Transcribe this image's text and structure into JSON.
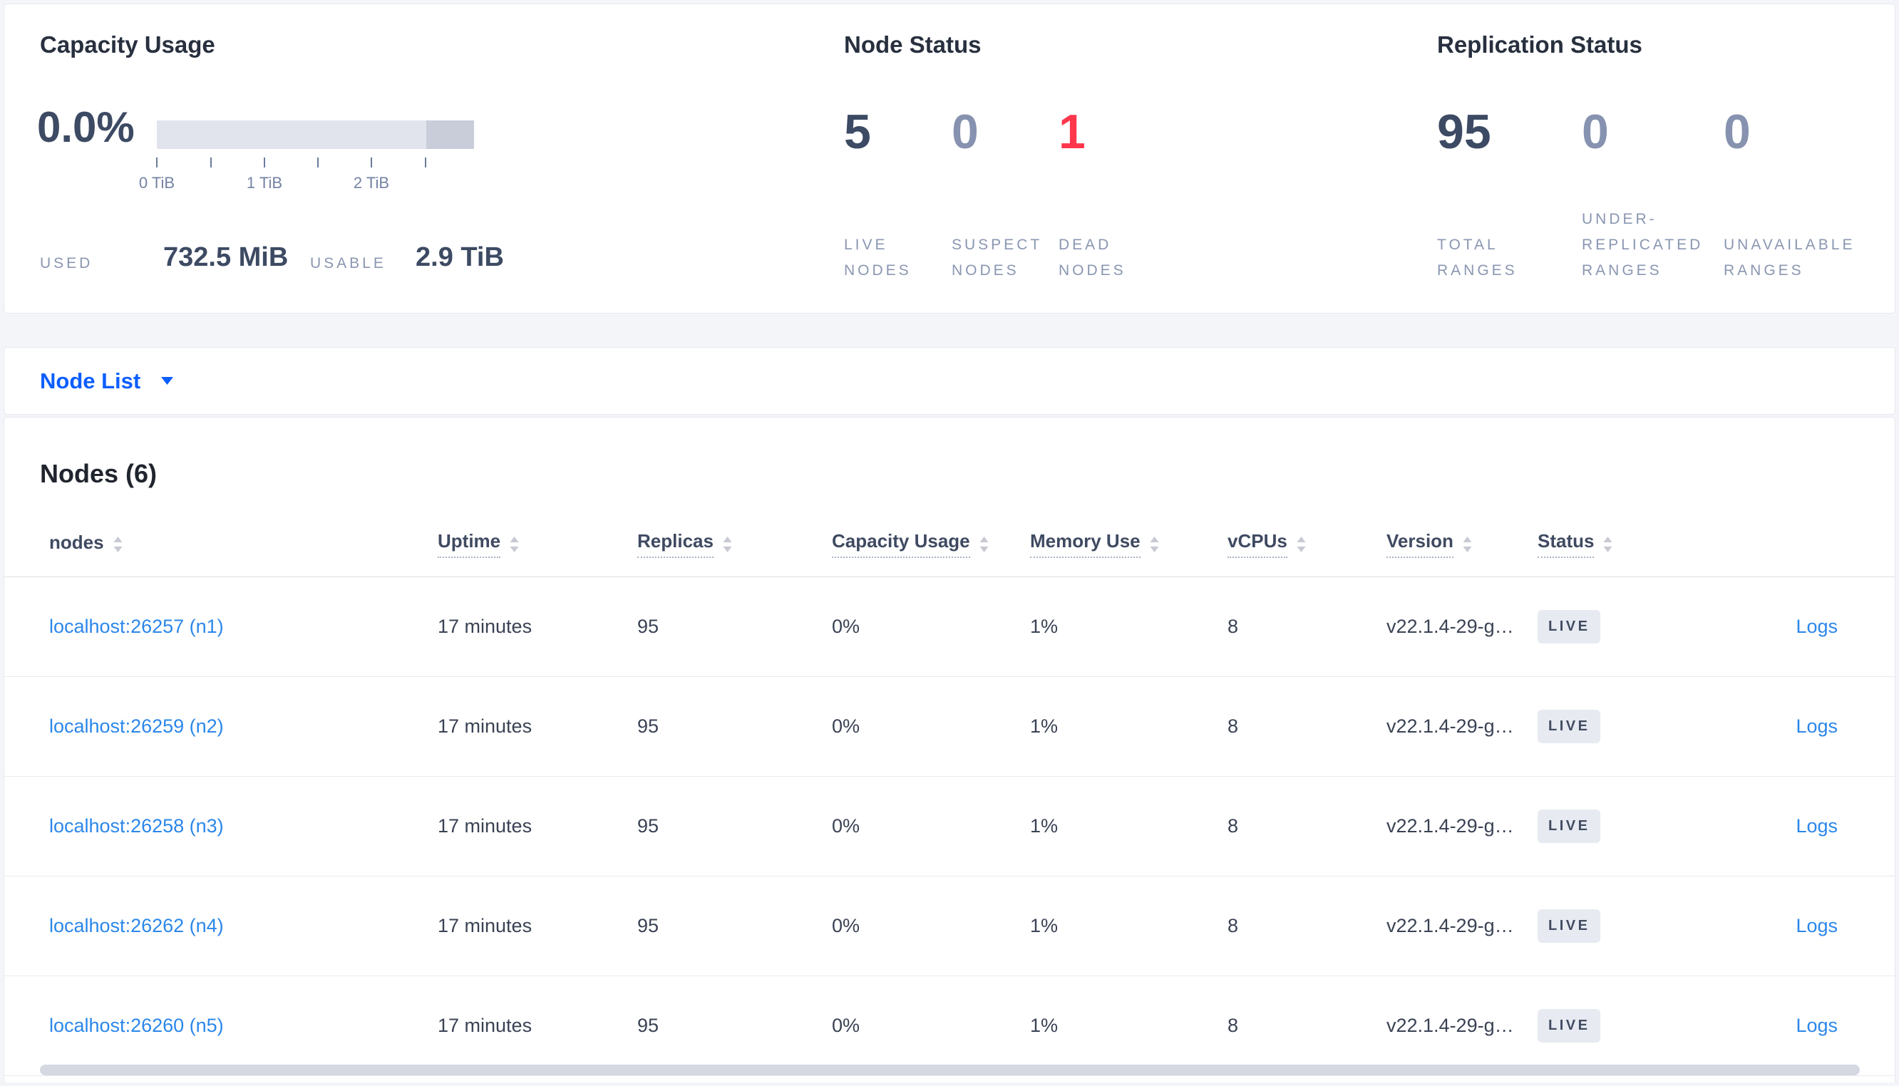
{
  "overview": {
    "capacity": {
      "title": "Capacity Usage",
      "percent": "0.0%",
      "tick_labels": [
        "0 TiB",
        "1 TiB",
        "2 TiB"
      ],
      "used_label": "USED",
      "used_value": "732.5 MiB",
      "usable_label": "USABLE",
      "usable_value": "2.9 TiB"
    },
    "node_status": {
      "title": "Node Status",
      "stats": [
        {
          "value": "5",
          "lines": [
            "LIVE",
            "NODES"
          ]
        },
        {
          "value": "0",
          "lines": [
            "SUSPECT",
            "NODES"
          ]
        },
        {
          "value": "1",
          "lines": [
            "DEAD",
            "NODES"
          ]
        }
      ]
    },
    "replication": {
      "title": "Replication Status",
      "stats": [
        {
          "value": "95",
          "lines": [
            "TOTAL",
            "RANGES"
          ]
        },
        {
          "value": "0",
          "lines": [
            "UNDER-",
            "REPLICATED",
            "RANGES"
          ]
        },
        {
          "value": "0",
          "lines": [
            "UNAVAILABLE",
            "RANGES"
          ]
        }
      ]
    }
  },
  "view_selector": {
    "label": "Node List"
  },
  "nodes": {
    "title": "Nodes (6)",
    "columns": [
      {
        "label": "nodes"
      },
      {
        "label": "Uptime"
      },
      {
        "label": "Replicas"
      },
      {
        "label": "Capacity Usage"
      },
      {
        "label": "Memory Use"
      },
      {
        "label": "vCPUs"
      },
      {
        "label": "Version"
      },
      {
        "label": "Status"
      }
    ],
    "rows": [
      {
        "address": "localhost:26257 (n1)",
        "uptime": "17 minutes",
        "replicas": "95",
        "capacity": "0%",
        "memory": "1%",
        "vcpus": "8",
        "version": "v22.1.4-29-g…",
        "status": "LIVE",
        "logs": "Logs"
      },
      {
        "address": "localhost:26259 (n2)",
        "uptime": "17 minutes",
        "replicas": "95",
        "capacity": "0%",
        "memory": "1%",
        "vcpus": "8",
        "version": "v22.1.4-29-g…",
        "status": "LIVE",
        "logs": "Logs"
      },
      {
        "address": "localhost:26258 (n3)",
        "uptime": "17 minutes",
        "replicas": "95",
        "capacity": "0%",
        "memory": "1%",
        "vcpus": "8",
        "version": "v22.1.4-29-g…",
        "status": "LIVE",
        "logs": "Logs"
      },
      {
        "address": "localhost:26262 (n4)",
        "uptime": "17 minutes",
        "replicas": "95",
        "capacity": "0%",
        "memory": "1%",
        "vcpus": "8",
        "version": "v22.1.4-29-g…",
        "status": "LIVE",
        "logs": "Logs"
      },
      {
        "address": "localhost:26260 (n5)",
        "uptime": "17 minutes",
        "replicas": "95",
        "capacity": "0%",
        "memory": "1%",
        "vcpus": "8",
        "version": "v22.1.4-29-g…",
        "status": "LIVE",
        "logs": "Logs"
      }
    ]
  },
  "colors": {
    "accent_blue": "#0b5eff",
    "link_blue": "#2b87ea",
    "danger_red": "#fd364c",
    "stat_primary": "#3d4a63",
    "stat_muted": "#8692af",
    "badge_bg": "#e7eaf1"
  }
}
